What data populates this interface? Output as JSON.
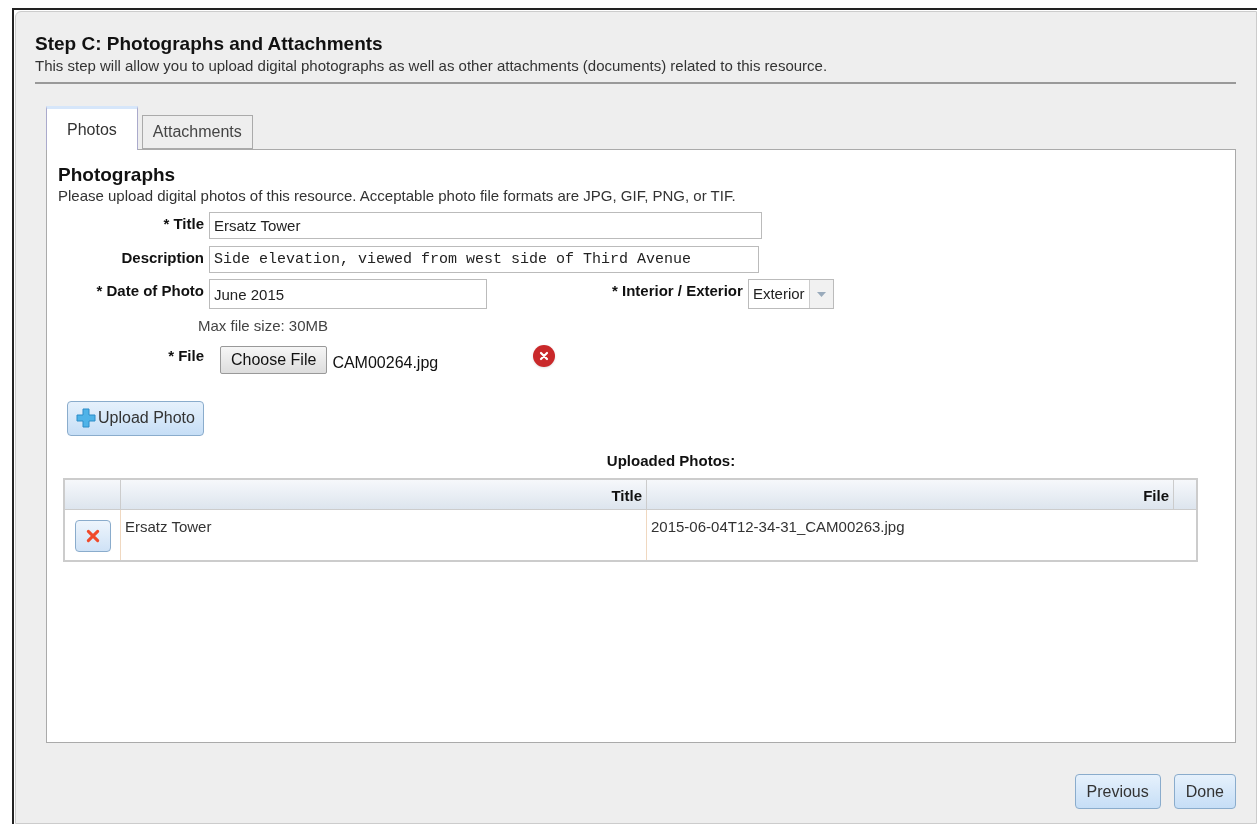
{
  "step": {
    "title": "Step C: Photographs and Attachments",
    "description": "This step will allow you to upload digital photographs as well as other attachments (documents) related to this resource."
  },
  "tabs": [
    {
      "label": "Photos",
      "selected": true
    },
    {
      "label": "Attachments",
      "selected": false
    }
  ],
  "section": {
    "title": "Photographs",
    "description": "Please upload digital photos of this resource. Acceptable photo file formats are JPG, GIF, PNG, or TIF."
  },
  "form": {
    "title": {
      "label": "* Title",
      "value": "Ersatz Tower"
    },
    "description": {
      "label": "Description",
      "value": "Side elevation, viewed from west side of Third Avenue"
    },
    "date": {
      "label": "* Date of Photo",
      "value": "June 2015"
    },
    "interior_exterior": {
      "label": "* Interior / Exterior",
      "value": "Exterior"
    },
    "max_size": "Max file size: 30MB",
    "file": {
      "label": "* File",
      "button": "Choose File",
      "filename": "CAM00264.jpg"
    },
    "upload_button": "Upload Photo"
  },
  "uploaded": {
    "title": "Uploaded Photos:",
    "columns": [
      "Title",
      "File"
    ],
    "rows": [
      {
        "title": "Ersatz Tower",
        "file": "2015-06-04T12-34-31_CAM00263.jpg"
      }
    ]
  },
  "buttons": [
    "Previous",
    "Done"
  ]
}
